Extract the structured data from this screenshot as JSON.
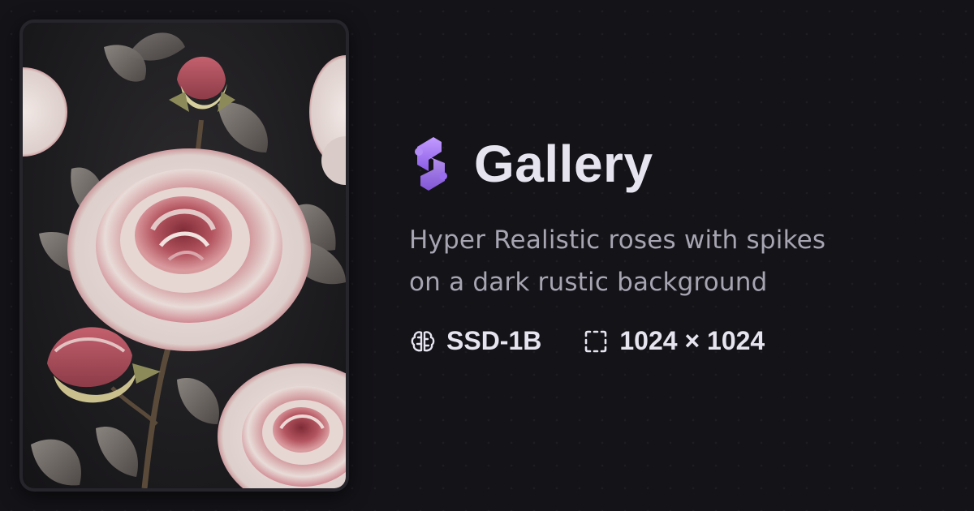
{
  "brand": {
    "title": "Gallery",
    "icon": "sdxl-logo-icon",
    "accent": "#a67cf0"
  },
  "description": "Hyper Realistic roses with spikes on a dark rustic background",
  "meta": {
    "model": {
      "icon": "brain-icon",
      "label": "SSD-1B"
    },
    "size": {
      "icon": "dashed-square-icon",
      "label": "1024 × 1024"
    }
  },
  "thumbnail": {
    "icon": "roses-artwork-image",
    "palette": [
      "#1d1c1f",
      "#e9dcd8",
      "#b9525f",
      "#7d7772",
      "#8d7f5a"
    ]
  }
}
